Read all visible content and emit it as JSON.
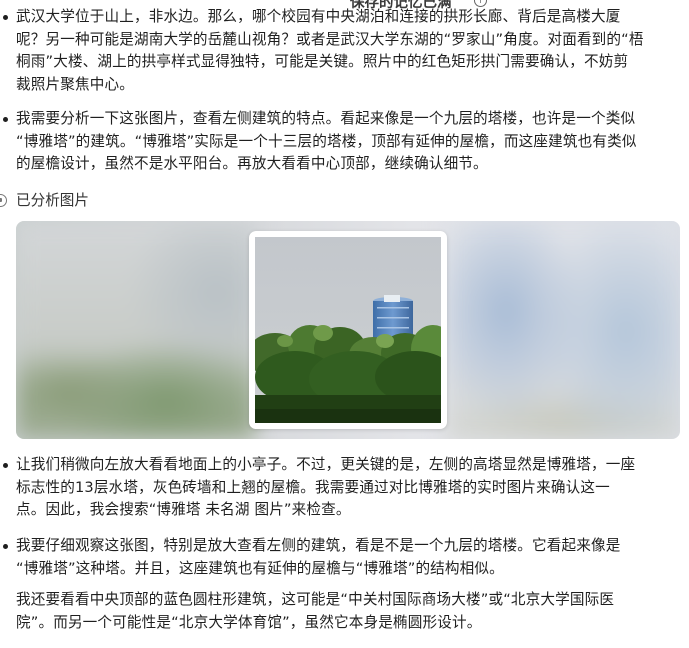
{
  "overlay_title": "保存的记忆已满",
  "paragraphs_top": [
    {
      "lines": [
        "武汉大学位于山上，非水边。那么，哪个校园有中央湖泊和连接的拱形长廊、背后是高楼大厦",
        "呢？另一种可能是湖南大学的岳麓山视角？或者是武汉大学东湖的“罗家山”角度。对面看到的“梧",
        "桐雨”大楼、湖上的拱亭样式显得独特，可能是关键。照片中的红色矩形拱门需要确认，不妨剪",
        "裁照片聚焦中心。"
      ]
    },
    {
      "lines": [
        "我需要分析一下这张图片，查看左侧建筑的特点。看起来像是一个九层的塔楼，也许是一个类似",
        "“博雅塔”的建筑。“博雅塔”实际是一个十三层的塔楼，顶部有延伸的屋檐，而这座建筑也有类似",
        "的屋檐设计，虽然不是水平阳台。再放大看看中心顶部，继续确认细节。"
      ]
    }
  ],
  "analyzed_label": "已分析图片",
  "paragraphs_bottom": [
    {
      "lines": [
        "让我们稍微向左放大看看地面上的小亭子。不过，更关键的是，左侧的高塔显然是博雅塔，一座",
        "标志性的13层水塔，灰色砖墙和上翘的屋檐。我需要通过对比博雅塔的实时图片来确认这一",
        "点。因此，我会搜索“博雅塔 未名湖 图片”来检查。"
      ]
    },
    {
      "lines": [
        "我要仔细观察这张图，特别是放大查看左侧的建筑，看是不是一个九层的塔楼。它看起来像是",
        "“博雅塔”这种塔。并且，这座建筑也有延伸的屋檐与“博雅塔”的结构相似。"
      ]
    },
    {
      "lines": [
        "我还要看看中央顶部的蓝色圆柱形建筑，这可能是“中关村国际商场大楼”或“北京大学国际医",
        "院”。而另一个可能性是“北京大学体育馆”，虽然它本身是椭圆形设计。"
      ]
    }
  ],
  "icons": [
    "info-circle-icon",
    "image-analysis-icon"
  ],
  "colors": {
    "text": "#1f1f1f",
    "muted": "#333333",
    "tree_green": "#2f5a1e",
    "building_blue": "#4f7fb8"
  }
}
